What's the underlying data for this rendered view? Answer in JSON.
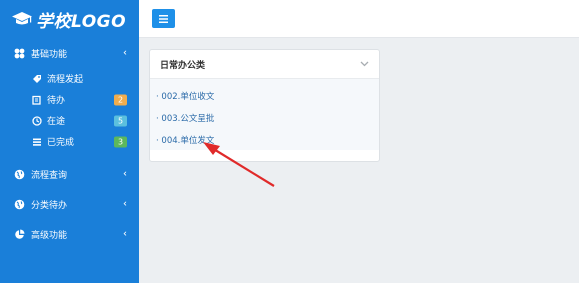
{
  "brand": {
    "logo_text": "学校LOGO"
  },
  "sidebar": {
    "groups": [
      {
        "label": "基础功能",
        "icon": "gears-icon",
        "expanded": true,
        "items": [
          {
            "label": "流程发起",
            "icon": "tag-icon",
            "badge": null
          },
          {
            "label": "待办",
            "icon": "edit-icon",
            "badge": "2",
            "badge_color": "#f0ad4e"
          },
          {
            "label": "在途",
            "icon": "clock-icon",
            "badge": "5",
            "badge_color": "#5bc0de"
          },
          {
            "label": "已完成",
            "icon": "list-icon",
            "badge": "3",
            "badge_color": "#5cb85c"
          }
        ]
      },
      {
        "label": "流程查询",
        "icon": "globe-icon"
      },
      {
        "label": "分类待办",
        "icon": "globe-icon"
      },
      {
        "label": "高级功能",
        "icon": "pie-icon"
      }
    ]
  },
  "panel": {
    "title": "日常办公类",
    "links": [
      "002.单位收文",
      "003.公文呈批",
      "004.单位发文"
    ]
  },
  "colors": {
    "sidebar_bg": "#1a7fd9",
    "toggle_bg": "#1e90e8",
    "link": "#2a6aa8",
    "annotation_arrow": "#e02a2a"
  }
}
